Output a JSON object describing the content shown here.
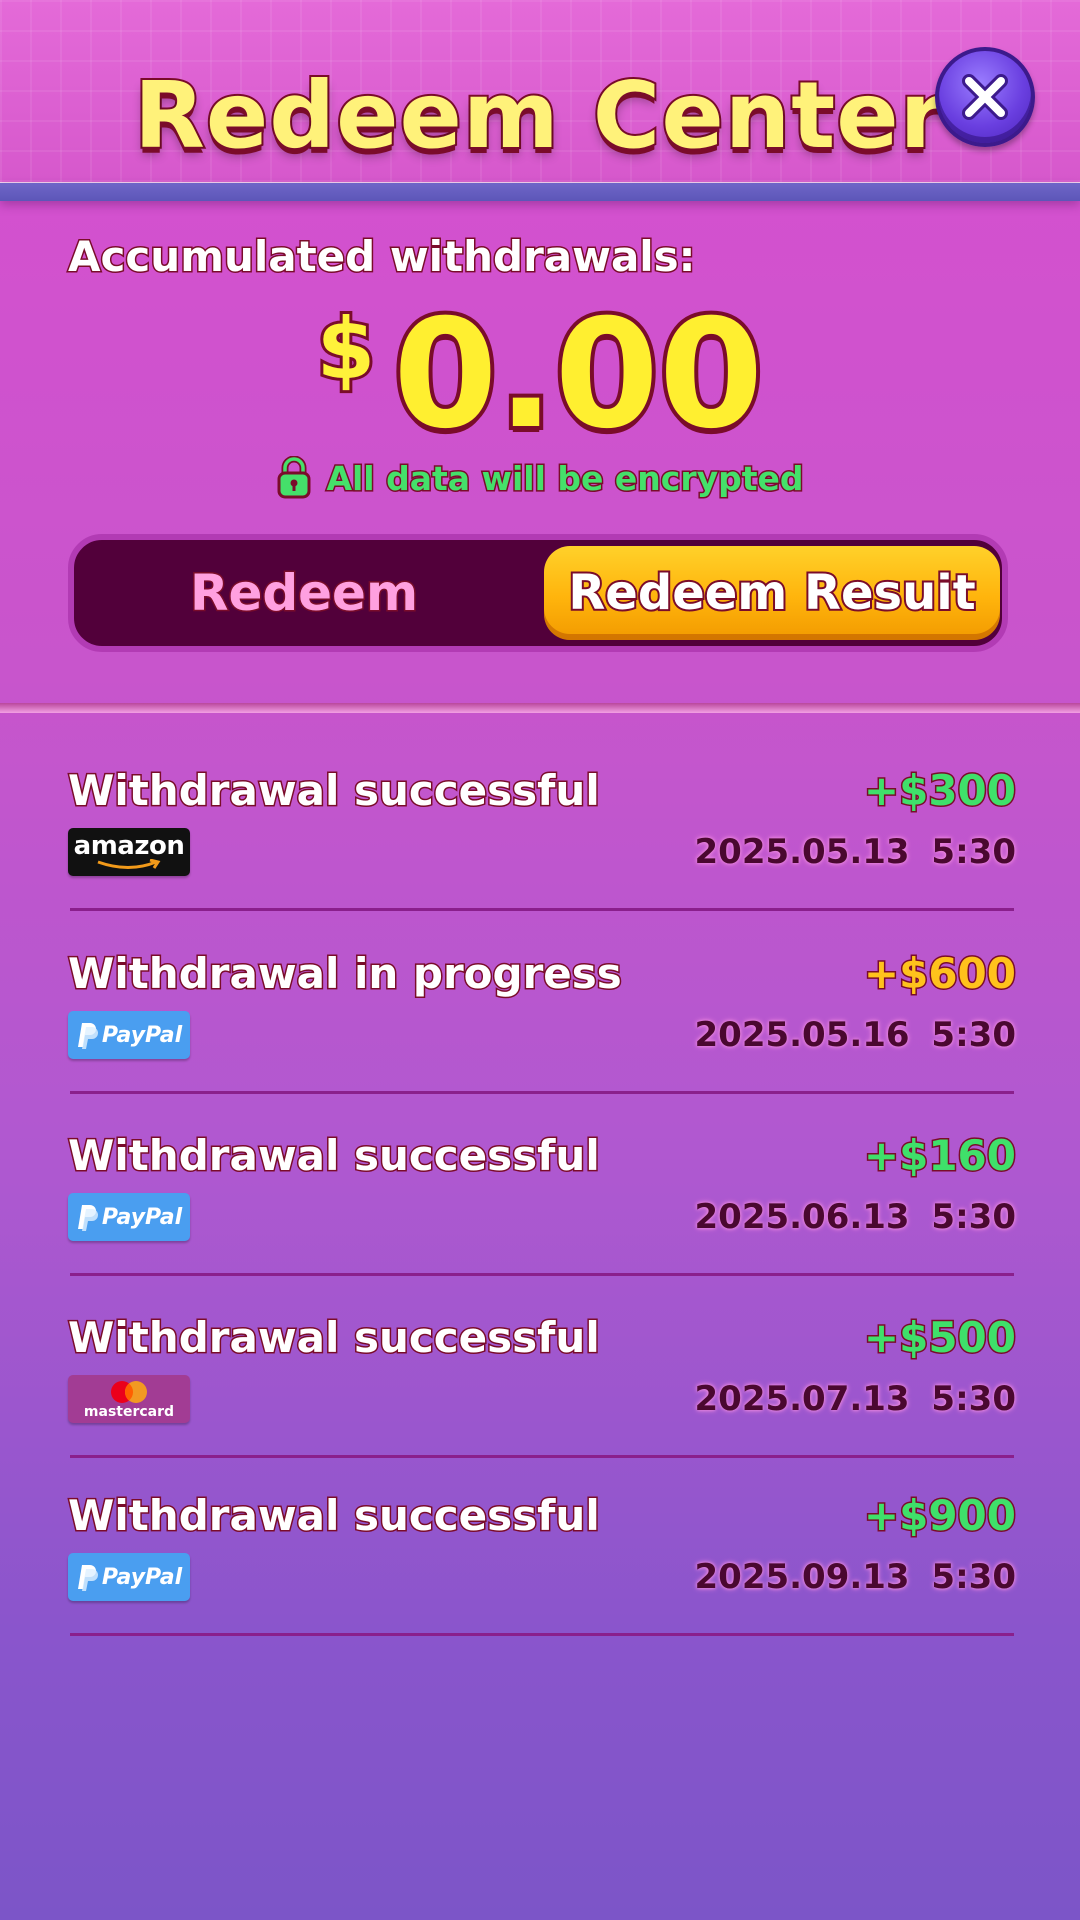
{
  "header": {
    "title": "Redeem Center"
  },
  "summary": {
    "label": "Accumulated withdrawals:",
    "currency": "$",
    "amount": "0.00",
    "encryption_note": "All data will be encrypted"
  },
  "tabs": [
    {
      "label": "Redeem",
      "active": false
    },
    {
      "label": "Redeem Resuit",
      "active": true
    }
  ],
  "records": [
    {
      "status": "Withdrawal successful",
      "amount": "+$300",
      "amount_color": "#3fe06a",
      "date": "2025.05.13  5:30",
      "method": "amazon",
      "method_label": "amazon"
    },
    {
      "status": "Withdrawal in progress",
      "amount": "+$600",
      "amount_color": "#ffc21c",
      "date": "2025.05.16  5:30",
      "method": "paypal",
      "method_label": "PayPal"
    },
    {
      "status": "Withdrawal successful",
      "amount": "+$160",
      "amount_color": "#3fe06a",
      "date": "2025.06.13  5:30",
      "method": "paypal",
      "method_label": "PayPal"
    },
    {
      "status": "Withdrawal successful",
      "amount": "+$500",
      "amount_color": "#3fe06a",
      "date": "2025.07.13  5:30",
      "method": "mastercard",
      "method_label": "mastercard"
    },
    {
      "status": "Withdrawal successful",
      "amount": "+$900",
      "amount_color": "#3fe06a",
      "date": "2025.09.13  5:30",
      "method": "paypal",
      "method_label": "PayPal"
    }
  ],
  "colors": {
    "title_fill": "#fff27a",
    "outline": "#7a0c2a",
    "success_green": "#3fe06a",
    "pending_orange": "#ffc21c",
    "tab_active": "#ffb40c",
    "tab_track": "#52003a"
  }
}
